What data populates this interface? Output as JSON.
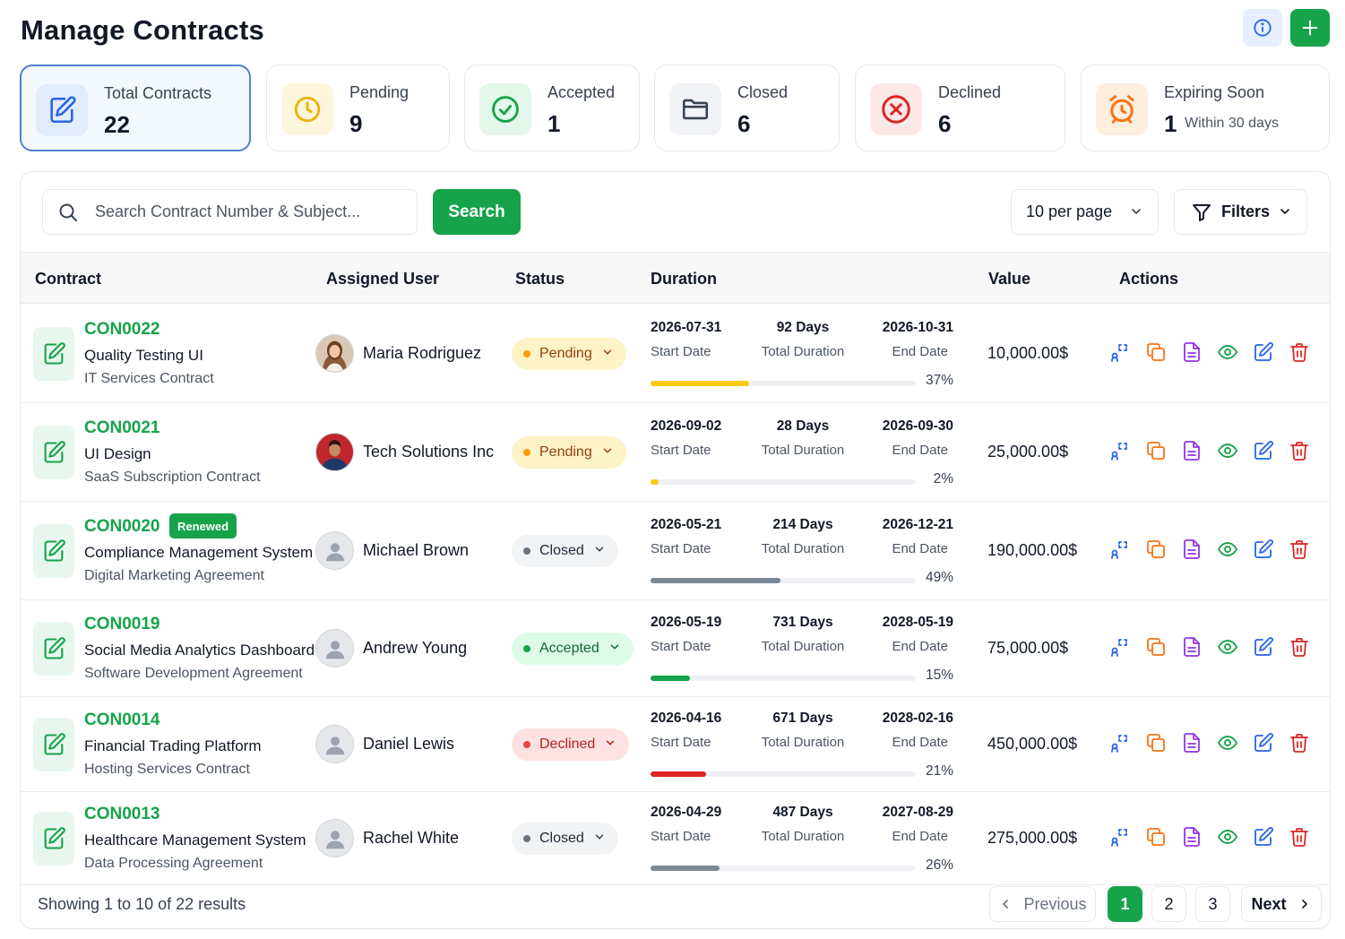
{
  "header": {
    "title": "Manage Contracts"
  },
  "summary": [
    {
      "label": "Total Contracts",
      "value": "22",
      "sub": "",
      "icon": "edit-document-icon",
      "color": "#2563eb"
    },
    {
      "label": "Pending",
      "value": "9",
      "sub": "",
      "icon": "clock-icon",
      "color": "#eab308"
    },
    {
      "label": "Accepted",
      "value": "1",
      "sub": "",
      "icon": "check-circle-icon",
      "color": "#16a34a"
    },
    {
      "label": "Closed",
      "value": "6",
      "sub": "",
      "icon": "folder-icon",
      "color": "#374151"
    },
    {
      "label": "Declined",
      "value": "6",
      "sub": "",
      "icon": "x-circle-icon",
      "color": "#dc2626"
    },
    {
      "label": "Expiring Soon",
      "value": "1",
      "sub": "Within 30 days",
      "icon": "alarm-clock-icon",
      "color": "#f97316"
    }
  ],
  "toolbar": {
    "search_placeholder": "Search Contract Number & Subject...",
    "search_label": "Search",
    "per_page": "10 per page",
    "filters_label": "Filters"
  },
  "table": {
    "columns": {
      "contract": "Contract",
      "user": "Assigned User",
      "status": "Status",
      "duration": "Duration",
      "value": "Value",
      "actions": "Actions"
    },
    "labels": {
      "start": "Start Date",
      "total": "Total Duration",
      "end": "End Date"
    },
    "rows": [
      {
        "code": "CON0022",
        "badge": "",
        "title": "Quality Testing UI",
        "type": "IT Services Contract",
        "user": "Maria Rodriguez",
        "avatar": "photo-woman",
        "status": "Pending",
        "status_kind": "pending",
        "start": "2026-07-31",
        "days": "92 Days",
        "end": "2026-10-31",
        "progress": "37%",
        "progress_value": 0.37,
        "value": "10,000.00$"
      },
      {
        "code": "CON0021",
        "badge": "",
        "title": "UI Design",
        "type": "SaaS Subscription Contract",
        "user": "Tech Solutions Inc",
        "avatar": "photo-man",
        "status": "Pending",
        "status_kind": "pending",
        "start": "2026-09-02",
        "days": "28 Days",
        "end": "2026-09-30",
        "progress": "2%",
        "progress_value": 0.02,
        "value": "25,000.00$"
      },
      {
        "code": "CON0020",
        "badge": "Renewed",
        "title": "Compliance Management System",
        "type": "Digital Marketing Agreement",
        "user": "Michael Brown",
        "avatar": "placeholder",
        "status": "Closed",
        "status_kind": "closed",
        "start": "2026-05-21",
        "days": "214 Days",
        "end": "2026-12-21",
        "progress": "49%",
        "progress_value": 0.49,
        "value": "190,000.00$"
      },
      {
        "code": "CON0019",
        "badge": "",
        "title": "Social Media Analytics Dashboard",
        "type": "Software Development Agreement",
        "user": "Andrew Young",
        "avatar": "placeholder",
        "status": "Accepted",
        "status_kind": "accepted",
        "start": "2026-05-19",
        "days": "731 Days",
        "end": "2028-05-19",
        "progress": "15%",
        "progress_value": 0.15,
        "value": "75,000.00$"
      },
      {
        "code": "CON0014",
        "badge": "",
        "title": "Financial Trading Platform",
        "type": "Hosting Services Contract",
        "user": "Daniel Lewis",
        "avatar": "placeholder",
        "status": "Declined",
        "status_kind": "declined",
        "start": "2026-04-16",
        "days": "671 Days",
        "end": "2028-02-16",
        "progress": "21%",
        "progress_value": 0.21,
        "value": "450,000.00$"
      },
      {
        "code": "CON0013",
        "badge": "",
        "title": "Healthcare Management System",
        "type": "Data Processing Agreement",
        "user": "Rachel White",
        "avatar": "placeholder",
        "status": "Closed",
        "status_kind": "closed",
        "start": "2026-04-29",
        "days": "487 Days",
        "end": "2027-08-29",
        "progress": "26%",
        "progress_value": 0.26,
        "value": "275,000.00$"
      }
    ]
  },
  "status_colors": {
    "pending": "#facc15",
    "closed": "#7c8798",
    "accepted": "#16a34a",
    "declined": "#e02424"
  },
  "action_icons": [
    "assign-icon",
    "copy-icon",
    "document-icon",
    "view-icon",
    "edit-icon",
    "delete-icon"
  ],
  "footer": {
    "showing": "Showing 1 to 10 of 22 results",
    "previous": "Previous",
    "next": "Next",
    "pages": [
      "1",
      "2",
      "3"
    ],
    "current_page": "1"
  }
}
